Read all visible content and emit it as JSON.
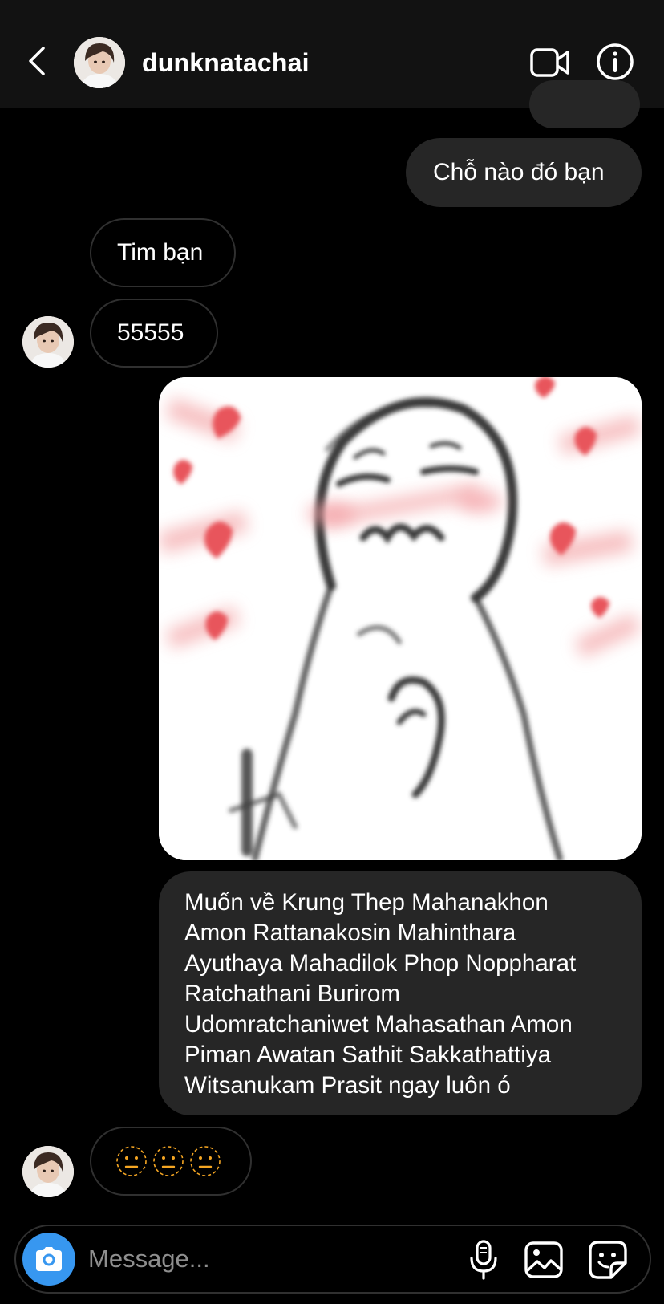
{
  "header": {
    "username": "dunknatachai"
  },
  "messages": [
    {
      "direction": "out",
      "text": "Chỗ nào đó bạn"
    },
    {
      "direction": "in",
      "text": "Tim bạn"
    },
    {
      "direction": "in",
      "text": "55555"
    },
    {
      "direction": "out",
      "type": "sticker",
      "description": "blushing-character-hearts"
    },
    {
      "direction": "out",
      "lines": [
        "Muốn về Krung Thep Mahanakhon",
        "Amon Rattanakosin Mahinthara",
        "Ayuthaya Mahadilok Phop Noppharat",
        "Ratchathani Burirom",
        "Udomratchaniwet Mahasathan Amon",
        "Piman Awatan Sathit Sakkathattiya",
        "Witsanukam Prasit ngay luôn ó"
      ]
    },
    {
      "direction": "in",
      "text": "😐😐😐",
      "emoji_count": 3
    }
  ],
  "composer": {
    "placeholder": "Message..."
  },
  "colors": {
    "background": "#000000",
    "header": "#121212",
    "outgoing_bubble": "#262626",
    "incoming_border": "#303030",
    "accent": "#3797f0",
    "placeholder": "#8e8e8e",
    "heart": "#e8555b"
  },
  "icons": [
    "chevron-left-icon",
    "video-call-icon",
    "info-icon",
    "camera-icon",
    "microphone-icon",
    "gallery-icon",
    "sticker-icon"
  ]
}
